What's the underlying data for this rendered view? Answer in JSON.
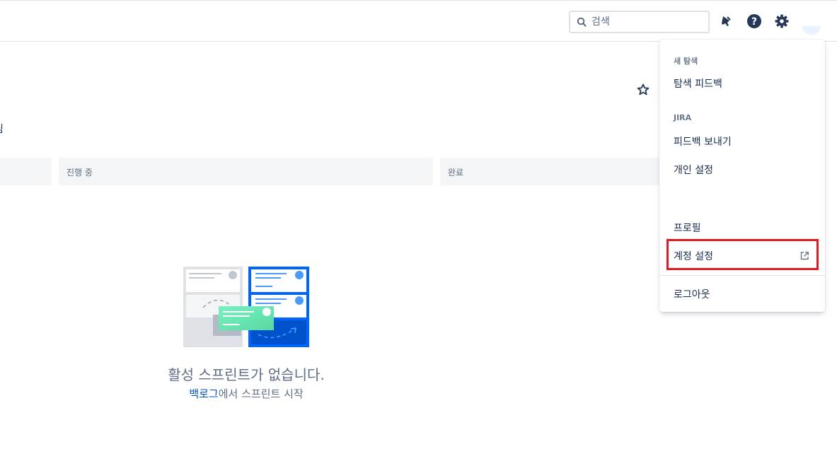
{
  "topbar": {
    "search_placeholder": "검색",
    "icons": [
      "search-icon",
      "notification-icon",
      "help-icon",
      "settings-icon"
    ]
  },
  "board": {
    "partial_text": "림",
    "columns": [
      {
        "label": ""
      },
      {
        "label": "진행 중"
      },
      {
        "label": "완료"
      }
    ],
    "empty_title": "활성 스프린트가 없습니다.",
    "empty_link": "백로그",
    "empty_suffix": "에서 스프린트 시작"
  },
  "menu": {
    "section1_header": "새 탐색",
    "section1_item": "탐색 피드백",
    "section2_header": "JIRA",
    "section2_items": [
      "피드백 보내기",
      "개인 설정"
    ],
    "profile": "프로필",
    "account_settings": "계정 설정",
    "logout": "로그아웃"
  },
  "colors": {
    "accent": "#0052CC",
    "highlight": "#E3191F",
    "column_bg": "#F4F5F7",
    "text": "#172B4D"
  }
}
